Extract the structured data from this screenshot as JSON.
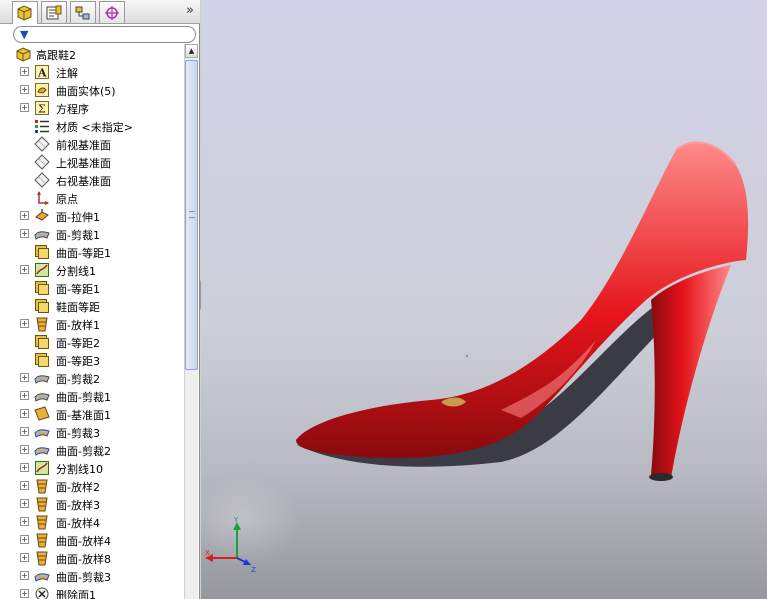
{
  "panel": {
    "tabs": [
      {
        "name": "tab-feature-manager",
        "icon": "feature-manager-icon"
      },
      {
        "name": "tab-property-manager",
        "icon": "property-manager-icon"
      },
      {
        "name": "tab-configuration-manager",
        "icon": "configuration-manager-icon"
      },
      {
        "name": "tab-dimxpert-manager",
        "icon": "crosshair-icon"
      }
    ],
    "expand_label": "»",
    "filter_icon": "filter-icon"
  },
  "tree": {
    "root": {
      "label": "高跟鞋2",
      "icon": "part-icon"
    },
    "items": [
      {
        "label": "注解",
        "icon": "annotation-icon",
        "expandable": true
      },
      {
        "label": "曲面实体(5)",
        "icon": "surface-bodies-icon",
        "expandable": true
      },
      {
        "label": "方程序",
        "icon": "equations-icon",
        "expandable": true
      },
      {
        "label": "材质 <未指定>",
        "icon": "material-icon",
        "expandable": false
      },
      {
        "label": "前视基准面",
        "icon": "plane-icon",
        "expandable": false
      },
      {
        "label": "上视基准面",
        "icon": "plane-icon",
        "expandable": false
      },
      {
        "label": "右视基准面",
        "icon": "plane-icon",
        "expandable": false
      },
      {
        "label": "原点",
        "icon": "origin-icon",
        "expandable": false
      },
      {
        "label": "面-拉伸1",
        "icon": "extrude-surface-icon",
        "expandable": true
      },
      {
        "label": "面-剪裁1",
        "icon": "trim-surface-icon",
        "expandable": true
      },
      {
        "label": "曲面-等距1",
        "icon": "offset-surface-icon",
        "expandable": false
      },
      {
        "label": "分割线1",
        "icon": "split-line-icon",
        "expandable": true
      },
      {
        "label": "面-等距1",
        "icon": "offset-surface-icon",
        "expandable": false
      },
      {
        "label": "鞋面等距",
        "icon": "offset-surface-icon",
        "expandable": false
      },
      {
        "label": "面-放样1",
        "icon": "loft-surface-icon",
        "expandable": true
      },
      {
        "label": "面-等距2",
        "icon": "offset-surface-icon",
        "expandable": false
      },
      {
        "label": "面-等距3",
        "icon": "offset-surface-icon",
        "expandable": false
      },
      {
        "label": "面-剪裁2",
        "icon": "trim-surface-icon",
        "expandable": true
      },
      {
        "label": "曲面-剪裁1",
        "icon": "trim-surface-icon",
        "expandable": true
      },
      {
        "label": "面-基准面1",
        "icon": "planar-surface-icon",
        "expandable": true
      },
      {
        "label": "面-剪裁3",
        "icon": "trim-surface-icon",
        "expandable": true
      },
      {
        "label": "曲面-剪裁2",
        "icon": "trim-surface-icon",
        "expandable": true
      },
      {
        "label": "分割线10",
        "icon": "split-line-icon",
        "expandable": true
      },
      {
        "label": "面-放样2",
        "icon": "loft-surface-icon",
        "expandable": true
      },
      {
        "label": "面-放样3",
        "icon": "loft-surface-icon",
        "expandable": true
      },
      {
        "label": "面-放样4",
        "icon": "loft-surface-icon",
        "expandable": true
      },
      {
        "label": "曲面-放样4",
        "icon": "loft-surface-icon",
        "expandable": true
      },
      {
        "label": "曲面-放样8",
        "icon": "loft-surface-icon",
        "expandable": true
      },
      {
        "label": "曲面-剪裁3",
        "icon": "trim-surface-icon",
        "expandable": true
      },
      {
        "label": "删除面1",
        "icon": "delete-face-icon",
        "expandable": true
      }
    ]
  },
  "viewport": {
    "model_name": "red-high-heel-shoe",
    "colors": {
      "shoe": "#e5141a",
      "highlight": "#ff8a8a",
      "shadow": "#8a0a0d",
      "sole": "#3a3b45",
      "insole": "#c99a4a"
    },
    "triad": {
      "x_label": "X",
      "y_label": "Y",
      "z_label": "Z"
    }
  }
}
